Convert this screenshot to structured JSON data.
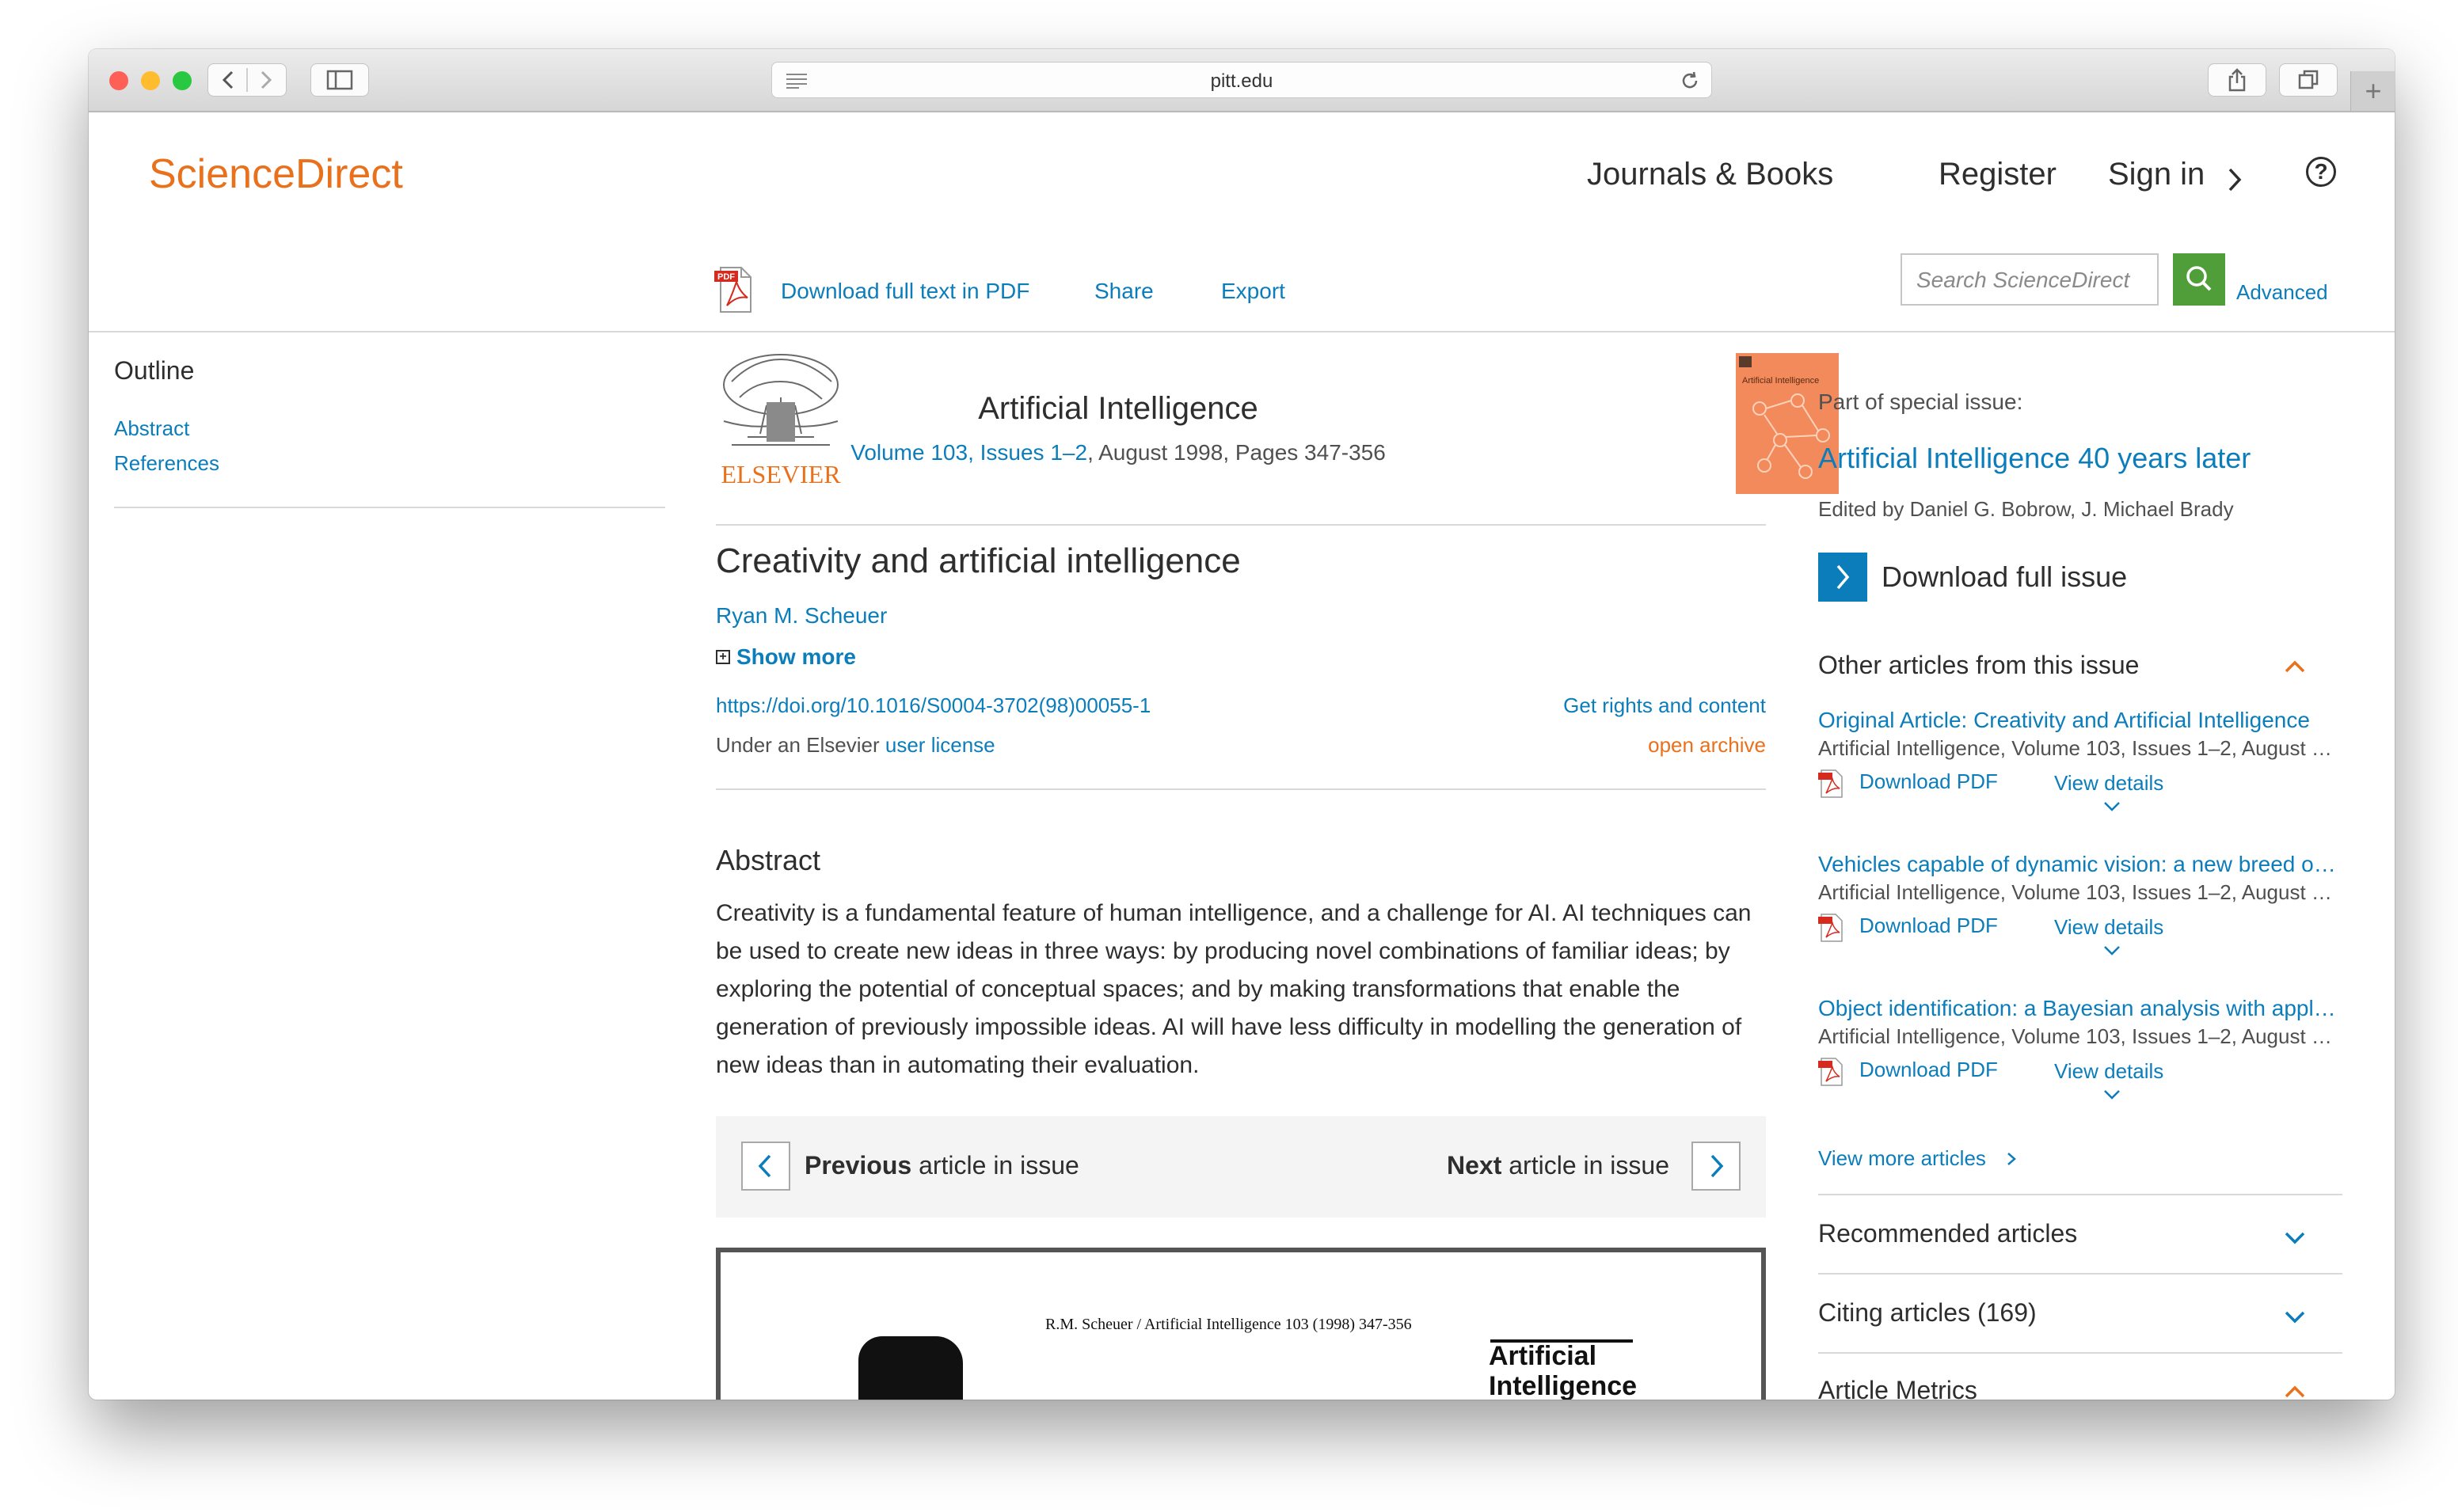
{
  "browser": {
    "url": "pitt.edu",
    "traffic_lights": [
      "#fe5f57",
      "#febc2e",
      "#28c840"
    ]
  },
  "site": {
    "logo": "ScienceDirect",
    "nav": {
      "journals": "Journals & Books",
      "register": "Register",
      "signin": "Sign in"
    },
    "help_symbol": "?",
    "accent_color": "#e9711c",
    "link_color": "#0c7dbb"
  },
  "toolbar": {
    "download_pdf": "Download full text in PDF",
    "share": "Share",
    "export": "Export",
    "search_placeholder": "Search ScienceDirect",
    "advanced": "Advanced"
  },
  "outline": {
    "title": "Outline",
    "items": [
      "Abstract",
      "References"
    ]
  },
  "journal": {
    "publisher": "ELSEVIER",
    "name": "Artificial Intelligence",
    "volume_link": "Volume 103, Issues 1–2",
    "issue_rest": ", August 1998, Pages 347-356",
    "cover_title": "Artificial Intelligence"
  },
  "article": {
    "title": "Creativity and artificial intelligence",
    "author": "Ryan M. Scheuer",
    "show_more": "Show more",
    "doi": "https://doi.org/10.1016/S0004-3702(98)00055-1",
    "rights": "Get rights and content",
    "license_prefix": "Under an Elsevier ",
    "license_link": "user license",
    "open_archive": "open archive",
    "abstract_title": "Abstract",
    "abstract_text": "Creativity is a fundamental feature of human intelligence, and a challenge for AI. AI techniques can be used to create new ideas in three ways: by producing novel combinations of familiar ideas; by exploring the potential of conceptual spaces; and by making transformations that enable the generation of previously impossible ideas. AI will have less difficulty in modelling the generation of new ideas than in automating their evaluation.",
    "prev_bold": "Previous",
    "prev_rest": " article in issue",
    "next_bold": "Next",
    "next_rest": " article in issue",
    "preview_running_head": "R.M. Scheuer / Artificial Intelligence 103 (1998) 347-356",
    "preview_journal_1": "Artificial",
    "preview_journal_2": "Intelligence"
  },
  "sidebar": {
    "special_label": "Part of special issue:",
    "special_title": "Artificial Intelligence 40 years later",
    "edited_by": "Edited by Daniel G. Bobrow, J. Michael Brady",
    "download_issue": "Download full issue",
    "other_title": "Other articles from this issue",
    "other_articles": [
      {
        "title": "Original Article: Creativity and Artificial Intelligence",
        "meta": "Artificial Intelligence, Volume 103, Issues 1–2, August …",
        "pdf": "Download PDF",
        "details": "View details"
      },
      {
        "title": "Vehicles capable of dynamic vision: a new breed o…",
        "meta": "Artificial Intelligence, Volume 103, Issues 1–2, August …",
        "pdf": "Download PDF",
        "details": "View details"
      },
      {
        "title": "Object identification: a Bayesian analysis with appl…",
        "meta": "Artificial Intelligence, Volume 103, Issues 1–2, August …",
        "pdf": "Download PDF",
        "details": "View details"
      }
    ],
    "view_more": "View more articles",
    "recommended": "Recommended articles",
    "citing": "Citing articles (169)",
    "metrics": "Article Metrics"
  }
}
